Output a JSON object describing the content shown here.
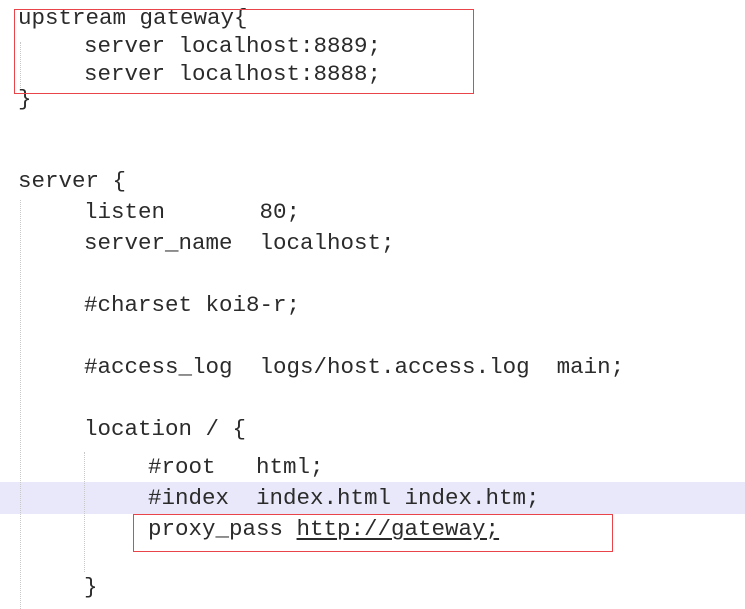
{
  "editor": {
    "highlight_color": "#e8e8fa",
    "annotation_color": "#e8444a",
    "lines": [
      {
        "indent": 0,
        "text": "upstream gateway{"
      },
      {
        "indent": 1,
        "text": "server localhost:8889;"
      },
      {
        "indent": 1,
        "text": "server localhost:8888;"
      },
      {
        "indent": 0,
        "text": "}"
      },
      {
        "indent": 0,
        "text": ""
      },
      {
        "indent": 0,
        "text": "server {"
      },
      {
        "indent": 1,
        "text": "listen       80;"
      },
      {
        "indent": 1,
        "text": "server_name  localhost;"
      },
      {
        "indent": 0,
        "text": ""
      },
      {
        "indent": 1,
        "text": "#charset koi8-r;"
      },
      {
        "indent": 0,
        "text": ""
      },
      {
        "indent": 1,
        "text": "#access_log  logs/host.access.log  main;"
      },
      {
        "indent": 0,
        "text": ""
      },
      {
        "indent": 1,
        "text": "location / {"
      },
      {
        "indent": 2,
        "text": "#root   html;"
      },
      {
        "indent": 2,
        "text": "#index  index.html index.htm;"
      },
      {
        "indent": 2,
        "prefix": "proxy_pass ",
        "link": "http://gateway;"
      },
      {
        "indent": 0,
        "text": ""
      },
      {
        "indent": 1,
        "text": "}"
      }
    ]
  }
}
